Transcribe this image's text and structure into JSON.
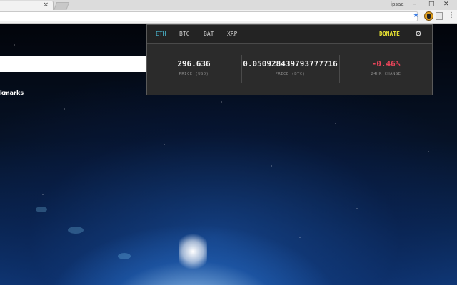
{
  "browser": {
    "tab": {
      "title": "",
      "close_glyph": "×"
    },
    "user_name": "ipsae",
    "window_controls": [
      "–",
      "□",
      "✕"
    ],
    "bookmark_star": "★",
    "menu_glyph": "⋮"
  },
  "page": {
    "bookmarks_label": "kmarks"
  },
  "popup": {
    "tabs": [
      "ETH",
      "BTC",
      "BAT",
      "XRP"
    ],
    "active_tab": "ETH",
    "donate_label": "DONATE",
    "settings_icon": "gear-icon",
    "settings_glyph": "⚙",
    "stats": {
      "price_usd": {
        "value": "296.636",
        "label": "PRICE (USD)"
      },
      "price_btc": {
        "value": "0.050928439793777716",
        "label": "PRICE (BTC)"
      },
      "change_24h": {
        "value": "-0.46%",
        "label": "24HR CHANGE"
      }
    },
    "colors": {
      "active_tab": "#4bb8d0",
      "donate": "#e6e033",
      "negative_change": "#e8455a",
      "popup_bg": "#2b2b2b"
    }
  }
}
